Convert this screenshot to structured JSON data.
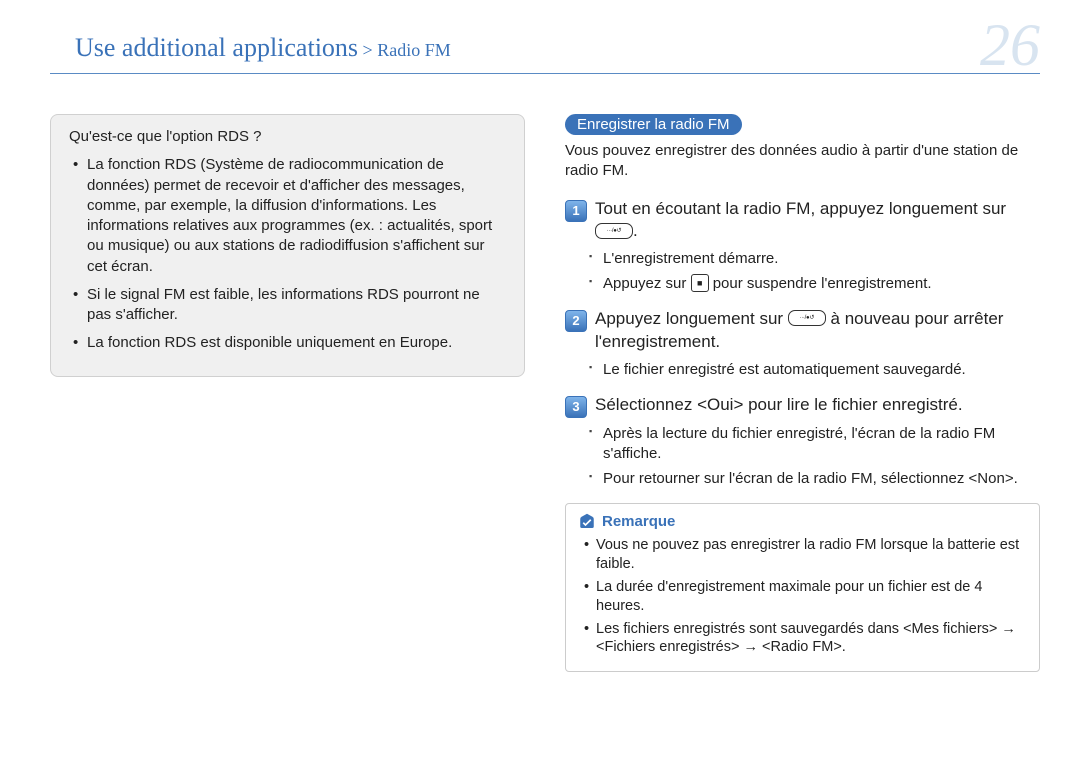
{
  "header": {
    "breadcrumb_main": "Use additional applications",
    "breadcrumb_sep": " > ",
    "breadcrumb_sub": "Radio FM",
    "page_number": "26"
  },
  "left": {
    "box_title": "Qu'est-ce que l'option RDS ?",
    "items": [
      "La fonction RDS (Système de radiocommunication de données) permet de recevoir et d'afficher des messages, comme, par exemple, la diffusion d'informations. Les informations relatives aux programmes (ex. : actualités, sport ou musique) ou aux stations de radiodiffusion s'affichent sur cet écran.",
      "Si le signal FM est faible, les informations RDS pourront ne pas s'afficher.",
      "La fonction RDS est disponible uniquement en Europe."
    ]
  },
  "right": {
    "pill": "Enregistrer la radio FM",
    "intro": "Vous pouvez enregistrer des données audio à partir d'une station de radio FM.",
    "steps": [
      {
        "num": "1",
        "text_before": "Tout en écoutant la radio FM, appuyez longuement sur ",
        "key": "···/●↺",
        "key_style": "pill",
        "text_after": ".",
        "subs": [
          {
            "plain": "L'enregistrement démarre."
          },
          {
            "before": "Appuyez sur ",
            "key": "■",
            "key_style": "square",
            "after": " pour suspendre l'enregistrement."
          }
        ]
      },
      {
        "num": "2",
        "text_before": "Appuyez longuement sur ",
        "key": "···/●↺",
        "key_style": "pill",
        "text_after": " à nouveau pour arrêter l'enregistrement.",
        "subs": [
          {
            "plain": "Le fichier enregistré est automatiquement sauvegardé."
          }
        ]
      },
      {
        "num": "3",
        "text_before": "Sélectionnez <Oui> pour lire le fichier enregistré.",
        "subs": [
          {
            "plain": "Après la lecture du fichier enregistré, l'écran de la radio FM s'affiche."
          },
          {
            "plain": "Pour retourner sur l'écran de la radio FM, sélectionnez <Non>."
          }
        ]
      }
    ],
    "note": {
      "label": "Remarque",
      "items": [
        "Vous ne pouvez pas enregistrer la radio FM lorsque la batterie est faible.",
        "La durée d'enregistrement maximale pour un fichier est de 4 heures.",
        "Les fichiers enregistrés sont sauvegardés dans <Mes fichiers> → <Fichiers enregistrés> → <Radio FM>."
      ]
    }
  }
}
